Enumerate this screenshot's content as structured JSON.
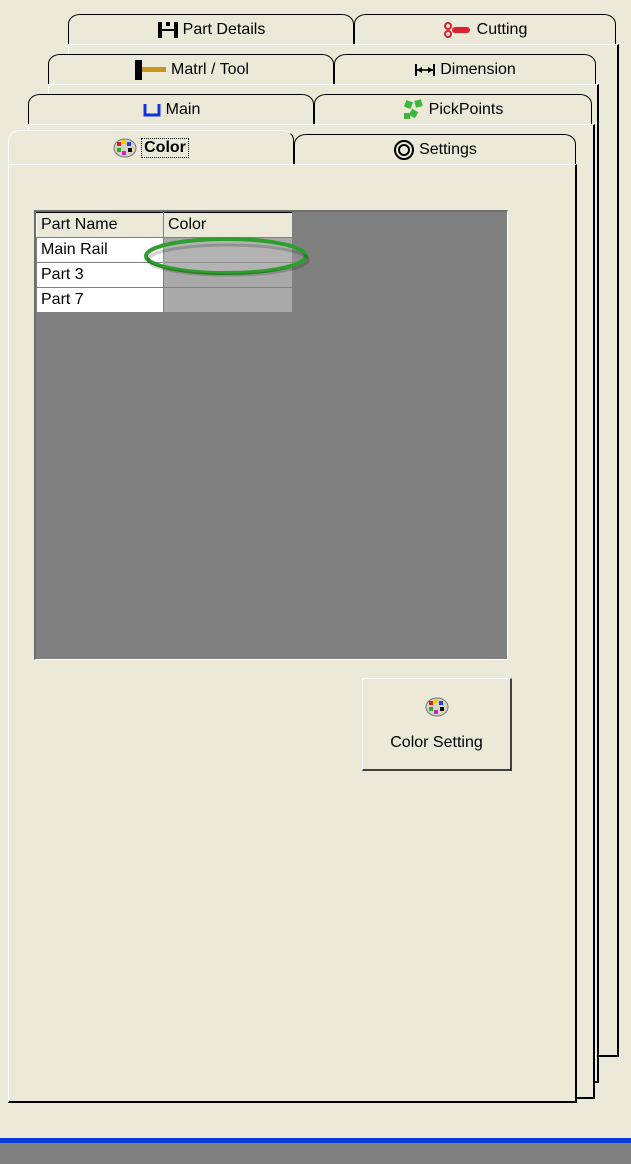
{
  "tabs": {
    "row1": [
      {
        "label": "Part Details",
        "icon": "part-details-icon"
      },
      {
        "label": "Cutting",
        "icon": "cutting-icon"
      }
    ],
    "row2": [
      {
        "label": "Matrl / Tool",
        "icon": "hammer-icon"
      },
      {
        "label": "Dimension",
        "icon": "dimension-icon"
      }
    ],
    "row3": [
      {
        "label": "Main",
        "icon": "main-u-icon"
      },
      {
        "label": "PickPoints",
        "icon": "pickpoints-icon"
      }
    ],
    "row4": [
      {
        "label": "Color",
        "icon": "palette-icon",
        "active": true
      },
      {
        "label": "Settings",
        "icon": "settings-icon"
      }
    ]
  },
  "grid": {
    "columns": [
      "Part Name",
      "Color"
    ],
    "rows": [
      {
        "name": "Main Rail",
        "color": ""
      },
      {
        "name": "Part 3",
        "color": ""
      },
      {
        "name": "Part 7",
        "color": ""
      }
    ]
  },
  "color_button": {
    "label": "Color Setting",
    "icon": "palette-icon"
  },
  "colors": {
    "panel_bg": "#ece9d8",
    "grid_bg": "#808080",
    "color_cell": "#a9a9a9",
    "highlight": "#2e9e2e",
    "taskbar_blue": "#0a3bd7"
  }
}
